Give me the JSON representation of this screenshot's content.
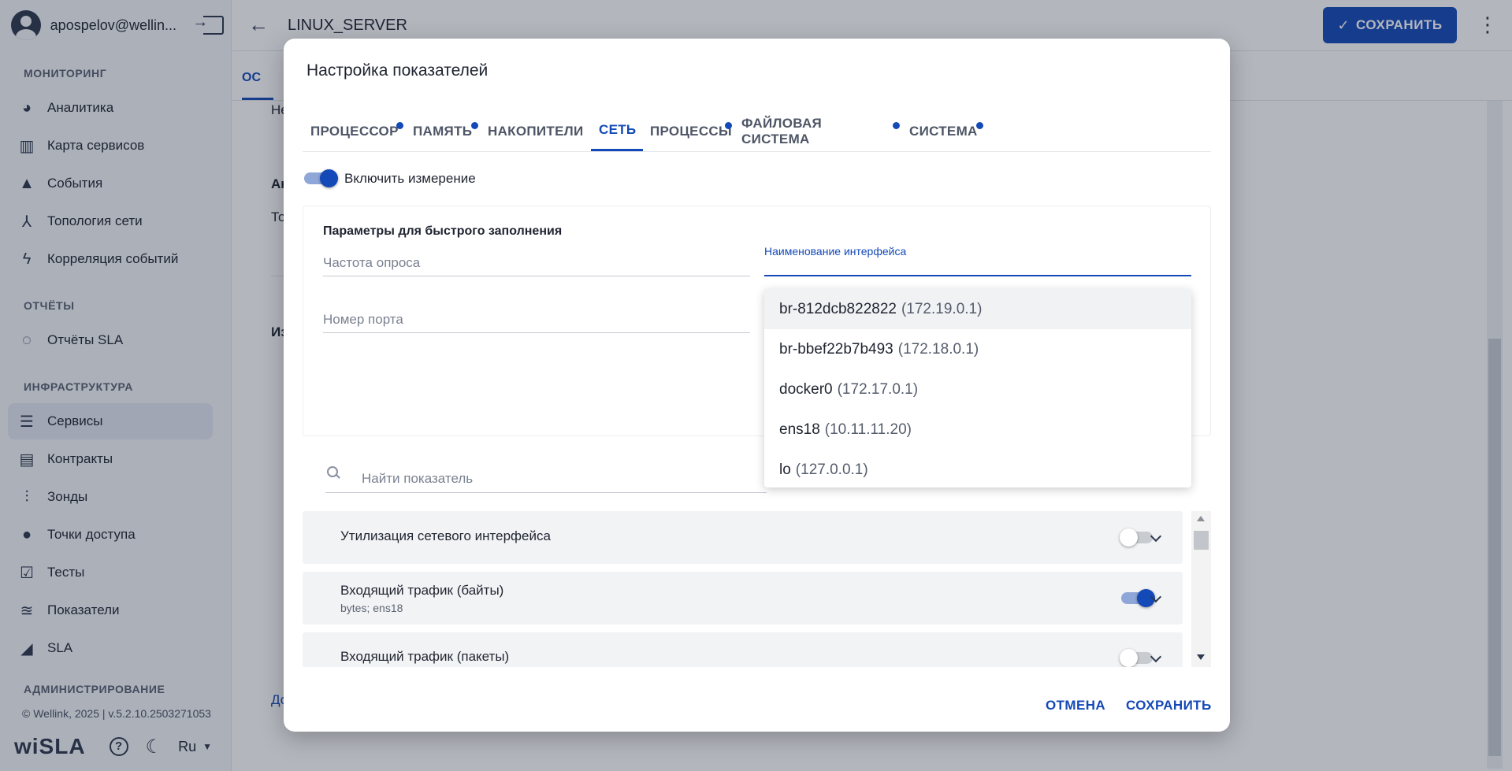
{
  "sidebar": {
    "user": "apospelov@wellin...",
    "sections": {
      "monitoring": "МОНИТОРИНГ",
      "reports": "ОТЧЁТЫ",
      "infrastructure": "ИНФРАСТРУКТУРА",
      "admin": "АДМИНИСТРИРОВАНИЕ"
    },
    "items": [
      {
        "label": "Аналитика",
        "icon": "pie-chart-icon"
      },
      {
        "label": "Карта сервисов",
        "icon": "map-icon"
      },
      {
        "label": "События",
        "icon": "warning-icon"
      },
      {
        "label": "Топология сети",
        "icon": "topology-icon"
      },
      {
        "label": "Корреляция событий",
        "icon": "bolt-icon"
      },
      {
        "label": "Отчёты SLA",
        "icon": "report-ring-icon"
      },
      {
        "label": "Сервисы",
        "icon": "list-icon"
      },
      {
        "label": "Контракты",
        "icon": "document-icon"
      },
      {
        "label": "Зонды",
        "icon": "probe-icon"
      },
      {
        "label": "Точки доступа",
        "icon": "circle-icon"
      },
      {
        "label": "Тесты",
        "icon": "checklist-icon"
      },
      {
        "label": "Показатели",
        "icon": "metrics-icon"
      },
      {
        "label": "SLA",
        "icon": "sla-settings-icon"
      }
    ],
    "footer": "© Wellink, 2025 | v.5.2.10.2503271053",
    "logo": "wiSLA",
    "lang": "Ru"
  },
  "header": {
    "title": "LINUX_SERVER",
    "save_label": "СОХРАНИТЬ"
  },
  "background": {
    "tab_label": "ОС",
    "texts": [
      "Не",
      "Ан",
      "То",
      "Из",
      "До"
    ]
  },
  "modal": {
    "title": "Настройка показателей",
    "tabs": [
      {
        "label": "ПРОЦЕССОР",
        "dot": true
      },
      {
        "label": "ПАМЯТЬ",
        "dot": true
      },
      {
        "label": "НАКОПИТЕЛИ",
        "dot": false
      },
      {
        "label": "СЕТЬ",
        "dot": true,
        "active": true
      },
      {
        "label": "ПРОЦЕССЫ",
        "dot": true
      },
      {
        "label": "ФАЙЛОВАЯ СИСТЕМА",
        "dot": true
      },
      {
        "label": "СИСТЕМА",
        "dot": true
      }
    ],
    "enable_label": "Включить измерение",
    "enable_on": true,
    "quick_fill": {
      "title": "Параметры для быстрого заполнения",
      "poll_placeholder": "Частота опроса",
      "port_placeholder": "Номер порта",
      "interface_label": "Наименование интерфейса"
    },
    "interface_options": [
      {
        "name": "br-812dcb822822",
        "ip": "(172.19.0.1)"
      },
      {
        "name": "br-bbef22b7b493",
        "ip": "(172.18.0.1)"
      },
      {
        "name": "docker0",
        "ip": "(172.17.0.1)"
      },
      {
        "name": "ens18",
        "ip": "(10.11.11.20)"
      },
      {
        "name": "lo",
        "ip": "(127.0.0.1)"
      }
    ],
    "search_placeholder": "Найти показатель",
    "metrics": [
      {
        "name": "Утилизация сетевого интерфейса",
        "sub": "",
        "enabled": false
      },
      {
        "name": "Входящий трафик (байты)",
        "sub": "bytes; ens18",
        "enabled": true
      },
      {
        "name": "Входящий трафик (пакеты)",
        "sub": "",
        "enabled": false
      }
    ],
    "cancel_label": "ОТМЕНА",
    "save_label": "СОХРАНИТЬ"
  }
}
